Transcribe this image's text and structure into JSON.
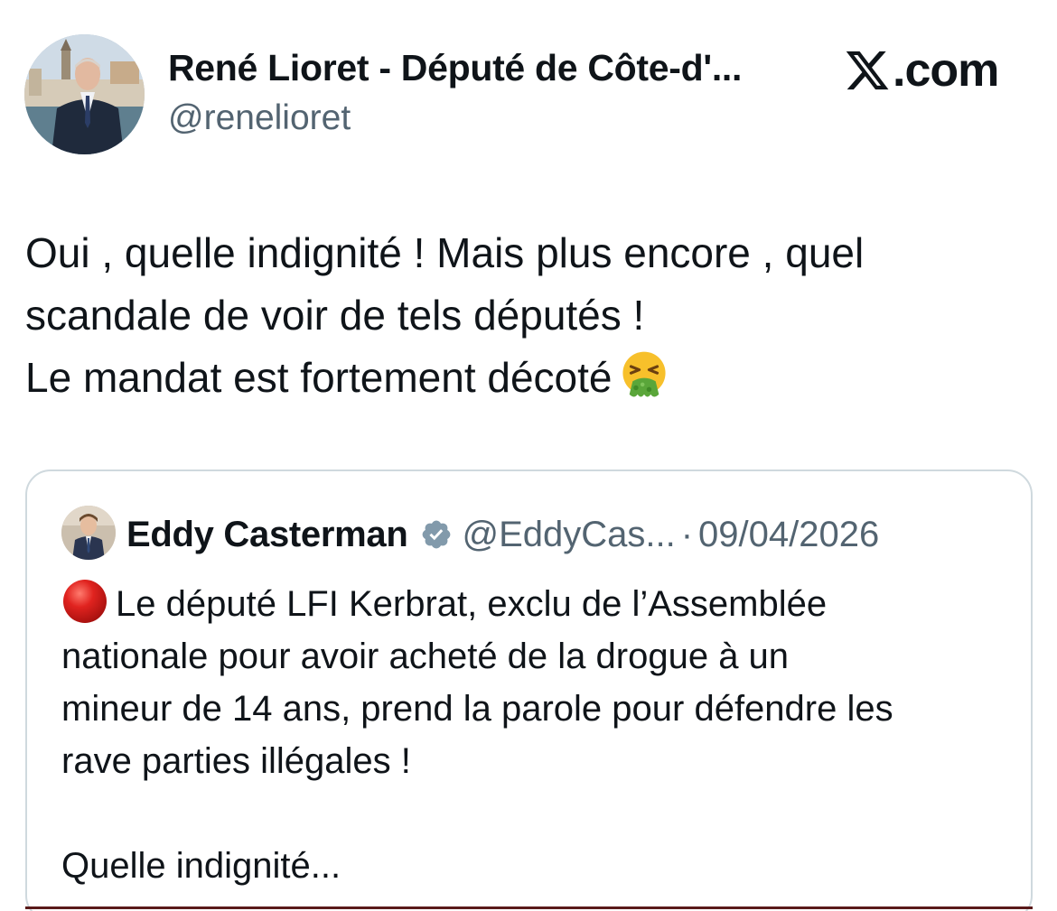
{
  "author": {
    "name": "René Lioret - Député de Côte-d'...",
    "handle": "@renelioret",
    "avatar_icon": "profile-photo"
  },
  "brand": {
    "icon": "x-logo-icon",
    "text": ".com"
  },
  "tweet": {
    "lines": [
      "Oui , quelle indignité ! Mais plus encore , quel",
      "scandale de voir de tels députés !",
      "Le mandat est fortement décoté"
    ],
    "emoji": "vomiting-face-icon"
  },
  "quoted": {
    "name": "Eddy Casterman",
    "verified_icon": "verified-badge-icon",
    "handle": "@EddyCas...",
    "separator": "·",
    "date": "09/04/2026",
    "marker_icon": "red-circle-icon",
    "lines": [
      "Le député LFI Kerbrat, exclu de l’Assemblée",
      "nationale pour avoir acheté de la drogue à un",
      "mineur de 14 ans, prend la parole pour défendre les",
      "rave parties illégales !"
    ],
    "closing": "Quelle indignité..."
  },
  "colors": {
    "text": "#0f1419",
    "secondary": "#536471",
    "border": "#cfd9de",
    "red_marker": "#e0231f"
  }
}
